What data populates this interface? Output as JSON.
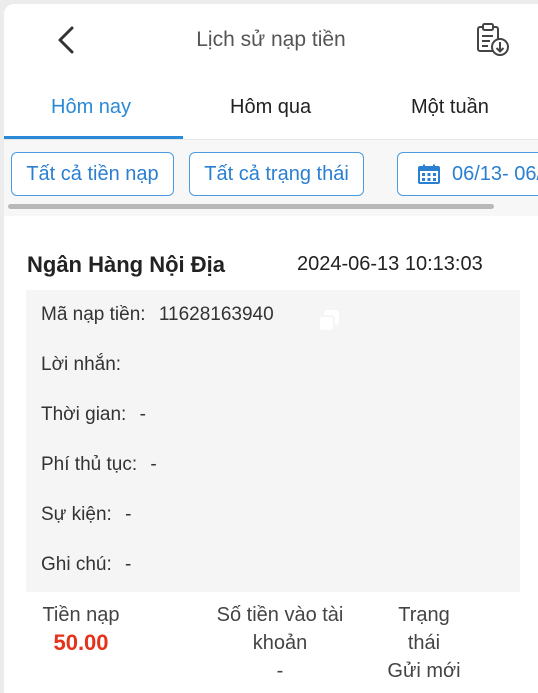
{
  "header": {
    "title": "Lịch sử nạp tiền",
    "back_icon": "chevron-left-icon",
    "export_icon": "clipboard-download-icon"
  },
  "tabs": [
    {
      "label": "Hôm nay",
      "active": true
    },
    {
      "label": "Hôm qua",
      "active": false
    },
    {
      "label": "Một tuần",
      "active": false
    }
  ],
  "filters": {
    "type_label": "Tất cả tiền nạp",
    "status_label": "Tất cả trạng thái",
    "date_label": "06/13- 06/",
    "date_icon": "calendar-icon"
  },
  "record": {
    "bank": "Ngân Hàng Nội Địa",
    "datetime": "2024-06-13 10:13:03",
    "details": [
      {
        "label": "Mã nạp tiền:",
        "value": "11628163940"
      },
      {
        "label": "Lời nhắn:",
        "value": ""
      },
      {
        "label": "Thời gian:",
        "value": "-"
      },
      {
        "label": "Phí thủ tục:",
        "value": "-"
      },
      {
        "label": "Sự kiện:",
        "value": "-"
      },
      {
        "label": "Ghi chú:",
        "value": "-"
      }
    ],
    "summary": {
      "amount_label": "Tiền nạp",
      "amount_value": "50.00",
      "credited_label_1": "Số tiền vào tài",
      "credited_label_2": "khoản",
      "credited_value": "-",
      "status_label_1": "Trạng",
      "status_label_2": "thái",
      "status_value": "Gửi mới"
    }
  },
  "colors": {
    "accent": "#2a8ad8",
    "amount": "#e4321b"
  }
}
